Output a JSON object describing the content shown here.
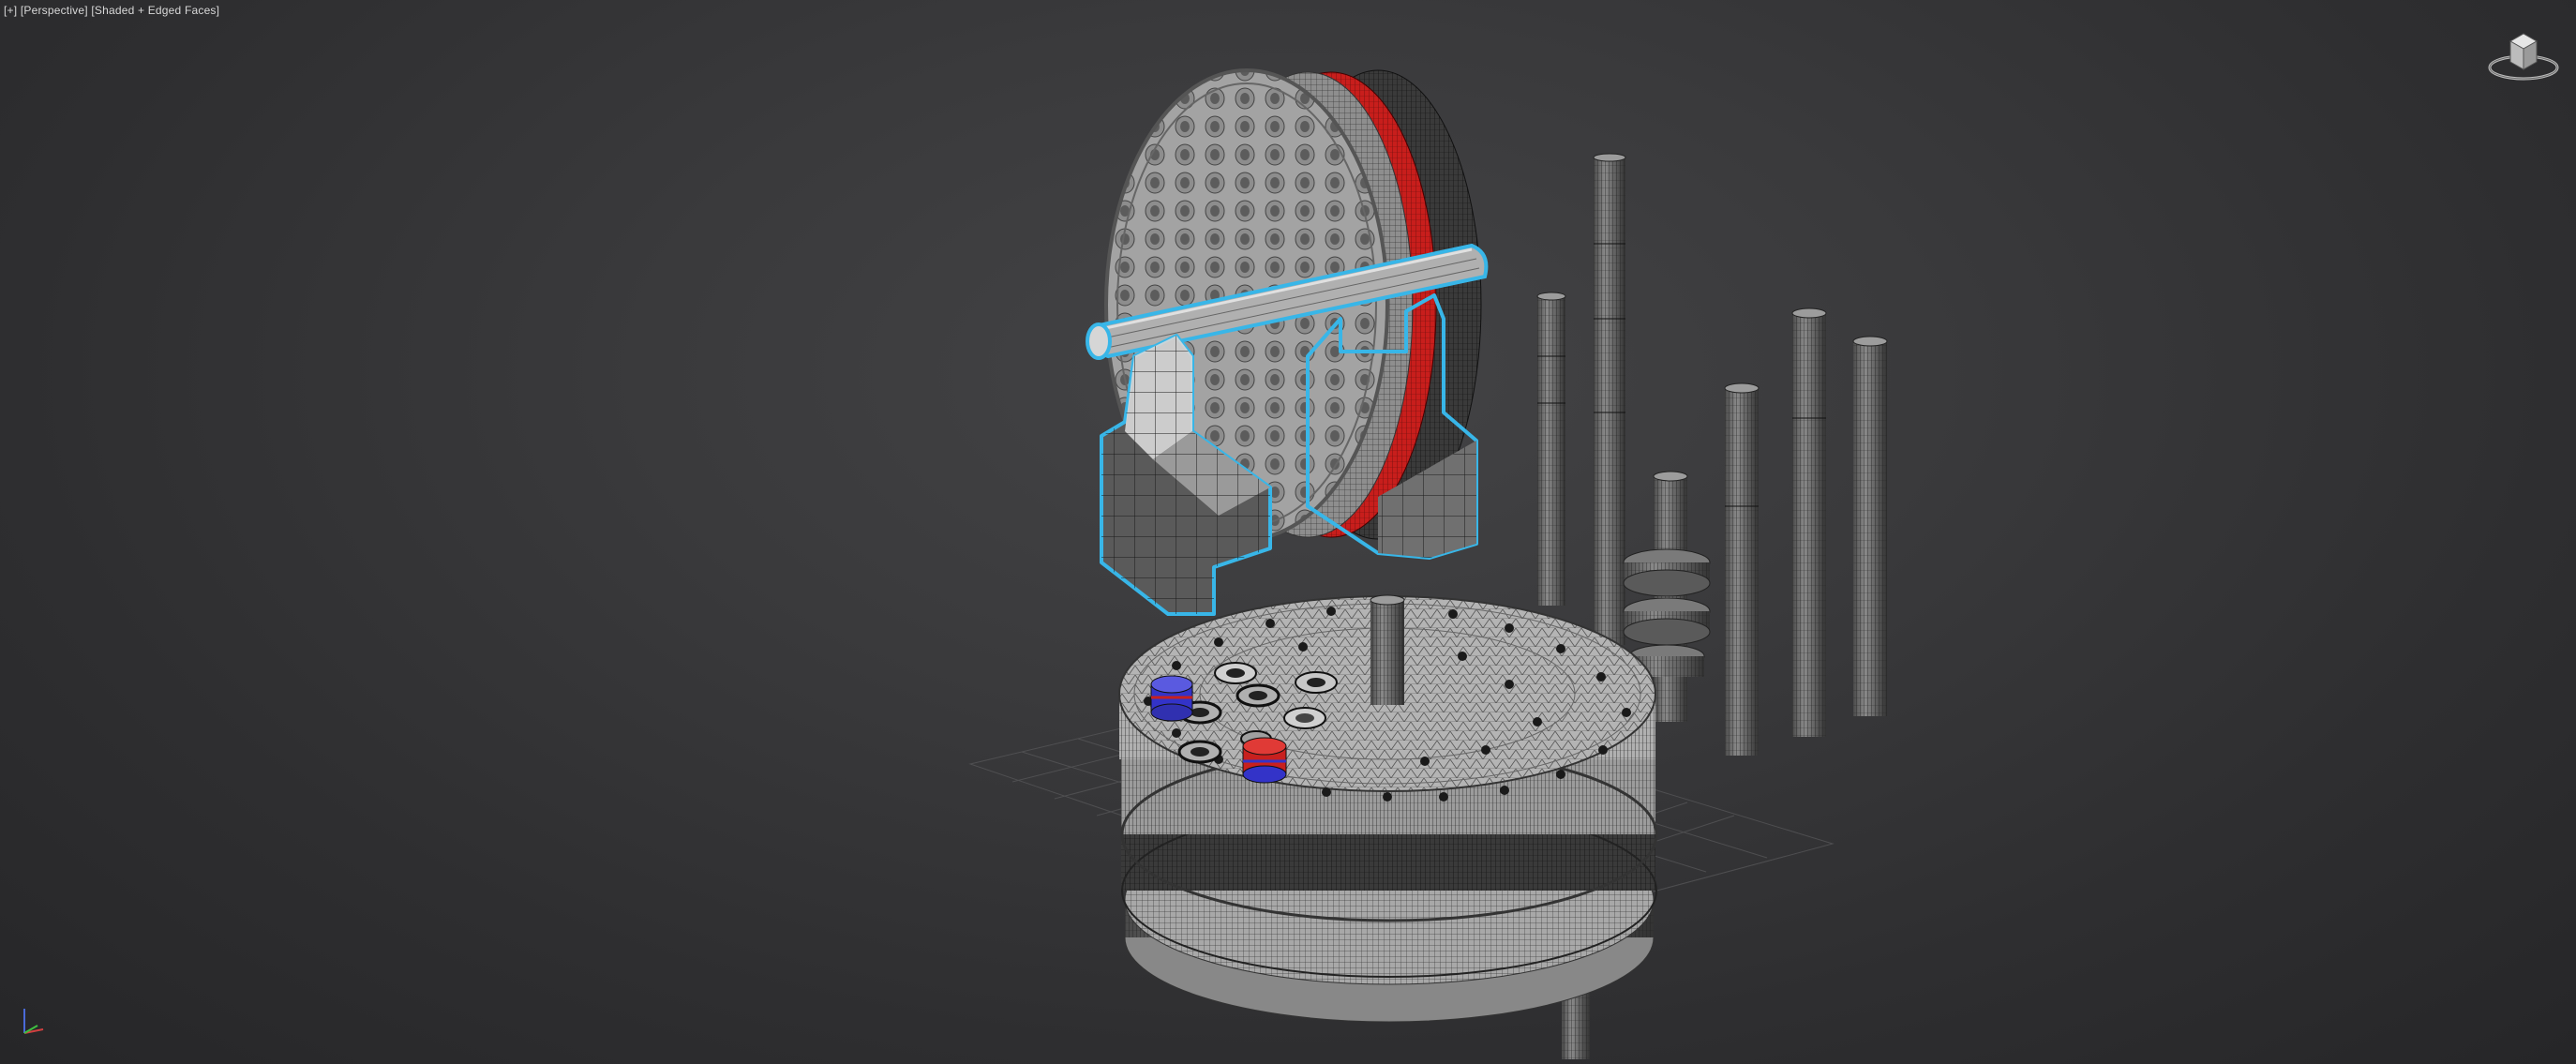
{
  "viewport": {
    "label_parts": {
      "menu": "[+]",
      "view": "[Perspective]",
      "shading": "[Shaded + Edged Faces]"
    },
    "view_type": "Perspective",
    "shading_mode": "Shaded + Edged Faces"
  },
  "viewcube": {
    "icon": "viewcube-icon"
  },
  "axis_tripod": {
    "icon": "axis-tripod-icon"
  },
  "colors": {
    "background": "#333335",
    "selection_outline": "#38b6e8",
    "red_band": "#c8201e",
    "blue_part": "#3333c8",
    "mesh": "#9a9a9a"
  }
}
